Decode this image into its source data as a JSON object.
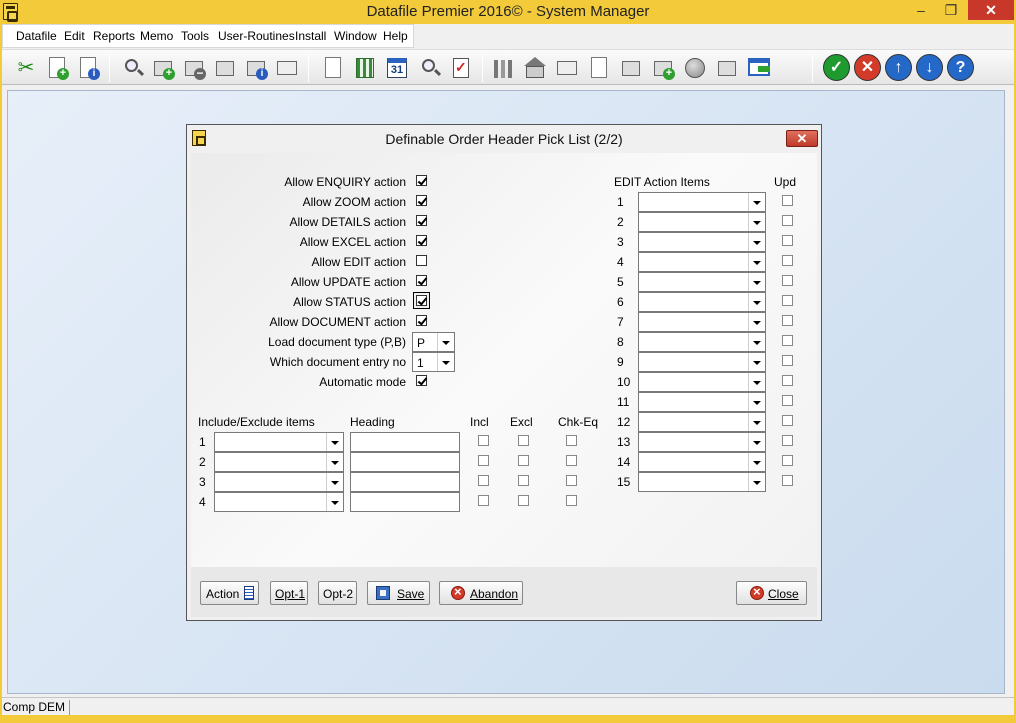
{
  "window": {
    "title": "Datafile  Premier 2016© - System Manager",
    "minimize": "–",
    "maximize": "❐",
    "close": "✕"
  },
  "menubar": [
    "Datafile",
    "Edit",
    "Reports",
    "Memo",
    "Tools",
    "User-Routines",
    "Install",
    "Window",
    "Help"
  ],
  "toolbar": {
    "calendar_number": "31",
    "icons": [
      "cut-icon",
      "add-document-icon",
      "document-info-icon",
      "search-icon",
      "add-record-icon",
      "remove-record-icon",
      "box-icon",
      "info-card-icon",
      "eraser-icon",
      "lock-document-icon",
      "spreadsheet-icon",
      "calendar-icon",
      "magnifier-icon",
      "checklist-icon",
      "chart-icon",
      "home-icon",
      "mail-icon",
      "word-document-icon",
      "picture-icon",
      "add-folder-icon",
      "globe-icon",
      "printer-icon",
      "export-icon",
      "ok-icon",
      "cancel-icon",
      "up-icon",
      "down-icon",
      "help-icon"
    ],
    "round_buttons": [
      {
        "name": "ok-button",
        "glyph": "✓",
        "color": "#1e9a2e"
      },
      {
        "name": "cancel-button",
        "glyph": "✕",
        "color": "#d23a2a"
      },
      {
        "name": "up-button",
        "glyph": "↑",
        "color": "#2468c8"
      },
      {
        "name": "down-button",
        "glyph": "↓",
        "color": "#2468c8"
      },
      {
        "name": "help-button",
        "glyph": "?",
        "color": "#2468c8"
      }
    ]
  },
  "dialog": {
    "title": "Definable Order Header Pick List (2/2)",
    "close": "✕",
    "options": [
      {
        "label": "Allow ENQUIRY action",
        "checked": true
      },
      {
        "label": "Allow ZOOM action",
        "checked": true
      },
      {
        "label": "Allow DETAILS action",
        "checked": true
      },
      {
        "label": "Allow EXCEL action",
        "checked": true
      },
      {
        "label": "Allow EDIT action",
        "checked": false
      },
      {
        "label": "Allow UPDATE action",
        "checked": true
      },
      {
        "label": "Allow STATUS action",
        "checked": true,
        "focused": true
      },
      {
        "label": "Allow DOCUMENT action",
        "checked": true
      }
    ],
    "load_doc_type": {
      "label": "Load document type (P,B)",
      "value": "P"
    },
    "doc_entry_no": {
      "label": "Which document entry no",
      "value": "1"
    },
    "automatic_mode": {
      "label": "Automatic mode",
      "checked": true
    },
    "include_exclude": {
      "header_items": "Include/Exclude items",
      "header_heading": "Heading",
      "header_incl": "Incl",
      "header_excl": "Excl",
      "header_chkeq": "Chk-Eq",
      "rows": [
        "1",
        "2",
        "3",
        "4"
      ]
    },
    "edit_action": {
      "header": "EDIT  Action Items",
      "header_upd": "Upd",
      "rows": [
        "1",
        "2",
        "3",
        "4",
        "5",
        "6",
        "7",
        "8",
        "9",
        "10",
        "11",
        "12",
        "13",
        "14",
        "15"
      ]
    },
    "buttons": {
      "action": "Action",
      "opt1": "Opt-1",
      "opt2": "Opt-2",
      "save": "Save",
      "abandon": "Abandon",
      "close": "Close"
    }
  },
  "status": {
    "company": "Comp DEM"
  }
}
